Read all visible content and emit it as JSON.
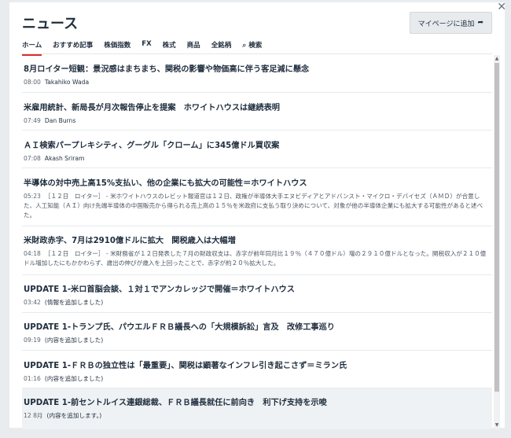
{
  "header": {
    "title": "ニュース",
    "mypage_label": "マイページに追加",
    "close_glyph": "✕"
  },
  "tabs": [
    {
      "label": "ホーム",
      "active": true
    },
    {
      "label": "おすすめ記事"
    },
    {
      "label": "株価指数"
    },
    {
      "label": "FX"
    },
    {
      "label": "株式"
    },
    {
      "label": "商品"
    },
    {
      "label": "全銘柄"
    },
    {
      "label": "検索",
      "icon": "search-icon"
    }
  ],
  "news": [
    {
      "title": "8月ロイター短観：景況感はまちまち、関税の影響や物価高に伴う客足減に懸念",
      "time": "08:00",
      "byline": "Takahiko Wada"
    },
    {
      "title": "米雇用統計、新局長が月次報告停止を提案　ホワイトハウスは継続表明",
      "time": "07:49",
      "byline": "Dan Burns"
    },
    {
      "title": "ＡＩ検索パープレキシティ、グーグル「クローム」に345億ドル買収案",
      "time": "07:08",
      "byline": "Akash Sriram"
    },
    {
      "title": "半導体の対中売上高15%支払い、他の企業にも拡大の可能性＝ホワイトハウス",
      "time": "05:23",
      "summary": "［１２日　ロイター］ - 米ホワイトハウスのレビット報道官は１２日、政権が半導体大手エヌビディアとアドバンスト・マイクロ・デバイセズ（ＡＭＤ）が合意した、人工知能（ＡＩ）向け先端半導体の中国販売から得られる売上高の１５％を米政府に支払う取り決めについて、対象が他の半導体企業にも拡大する可能性があると述べた。"
    },
    {
      "title": "米財政赤字、7月は2910億ドルに拡大　関税歳入は大幅増",
      "time": "04:18",
      "summary": "［１２日　ロイター］ - 米財務省が１２日発表した７月の財政収支は、赤字が前年同月比１９％（４７０億ドル）増の２９１０億ドルとなった。関税収入が２１０億ドル増加したにもかかわらず、歳出の伸びが歳入を上回ったことで、赤字が約２０％拡大した。"
    },
    {
      "title": "UPDATE 1-米ロ首脳会談、１対１でアンカレッジで開催＝ホワイトハウス",
      "time": "03:42",
      "byline": "(情報を追加しました)"
    },
    {
      "title": "UPDATE 1-トランプ氏、パウエルＦＲＢ議長への「大規模訴訟」言及　改修工事巡り",
      "time": "09:19",
      "byline": "(内容を追加しました)"
    },
    {
      "title": "UPDATE 1-ＦＲＢの独立性は「最重要」、関税は顕著なインフレ引き起こさず＝ミラン氏",
      "time": "01:16",
      "byline": "(内容を追加しました)"
    },
    {
      "title": "UPDATE 1-前セントルイス連銀総裁、ＦＲＢ議長就任に前向き　利下げ支持を示唆",
      "time": "12 8月",
      "byline": "(内容を追加します。)"
    }
  ]
}
